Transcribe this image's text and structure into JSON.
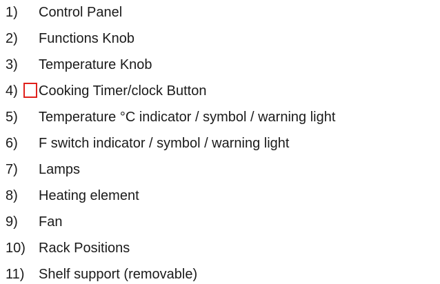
{
  "items": [
    {
      "number": "1)",
      "label": "Control Panel"
    },
    {
      "number": "2)",
      "label": "Functions Knob"
    },
    {
      "number": "3)",
      "label": "Temperature Knob"
    },
    {
      "number": "4)",
      "label": "Cooking Timer/clock Button"
    },
    {
      "number": "5)",
      "label": "Temperature °C indicator / symbol / warning light"
    },
    {
      "number": "6)",
      "label": "F switch indicator / symbol / warning light"
    },
    {
      "number": "7)",
      "label": "Lamps"
    },
    {
      "number": "8)",
      "label": "Heating element"
    },
    {
      "number": "9)",
      "label": "Fan"
    },
    {
      "number": "10)",
      "label": "Rack Positions"
    },
    {
      "number": "11)",
      "label": "Shelf support (removable)"
    }
  ],
  "highlight": {
    "item_index": 3,
    "color": "#e0201b"
  }
}
